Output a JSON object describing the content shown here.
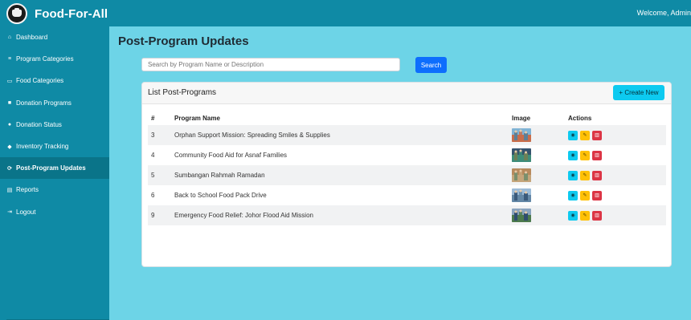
{
  "app": {
    "title": "Food-For-All",
    "welcome": "Welcome, Admin"
  },
  "sidebar": {
    "items": [
      {
        "label": "Dashboard",
        "icon": "home-icon",
        "glyph": "⌂",
        "active": false
      },
      {
        "label": "Program Categories",
        "icon": "list-icon",
        "glyph": "≡",
        "active": false
      },
      {
        "label": "Food Categories",
        "icon": "folder-icon",
        "glyph": "▭",
        "active": false
      },
      {
        "label": "Donation Programs",
        "icon": "box-icon",
        "glyph": "■",
        "active": false
      },
      {
        "label": "Donation Status",
        "icon": "check-circle-icon",
        "glyph": "●",
        "active": false
      },
      {
        "label": "Inventory Tracking",
        "icon": "diamond-icon",
        "glyph": "◆",
        "active": false
      },
      {
        "label": "Post-Program Updates",
        "icon": "refresh-icon",
        "glyph": "⟳",
        "active": true
      },
      {
        "label": "Reports",
        "icon": "file-icon",
        "glyph": "▤",
        "active": false
      },
      {
        "label": "Logout",
        "icon": "logout-icon",
        "glyph": "⇥",
        "active": false
      }
    ]
  },
  "main": {
    "title": "Post-Program Updates",
    "search": {
      "placeholder": "Search by Program Name or Description",
      "value": "",
      "button": "Search"
    },
    "card": {
      "title": "List Post-Programs",
      "create_button": "+ Create New",
      "columns": [
        "#",
        "Program Name",
        "Image",
        "Actions"
      ],
      "rows": [
        {
          "id": "3",
          "name": "Orphan Support Mission: Spreading Smiles & Supplies"
        },
        {
          "id": "4",
          "name": "Community Food Aid for Asnaf Families"
        },
        {
          "id": "5",
          "name": "Sumbangan Rahmah Ramadan"
        },
        {
          "id": "6",
          "name": "Back to School Food Pack Drive"
        },
        {
          "id": "9",
          "name": "Emergency Food Relief: Johor Flood Aid Mission"
        }
      ]
    }
  },
  "colors": {
    "sidebar": "#0f8aa5",
    "sidebar_active": "#0a7489",
    "main_bg": "#6dd4e7",
    "primary": "#0d6efd",
    "info": "#0dcaf0",
    "warning": "#ffc107",
    "danger": "#dc3545"
  }
}
